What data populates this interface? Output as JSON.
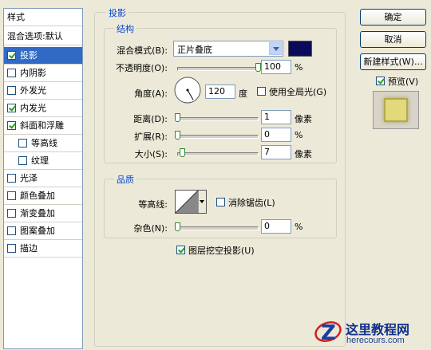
{
  "sidebar": {
    "header": "样式",
    "blend_options": "混合选项:默认",
    "items": [
      {
        "label": "投影",
        "checked": true,
        "selected": true
      },
      {
        "label": "内阴影",
        "checked": false
      },
      {
        "label": "外发光",
        "checked": false
      },
      {
        "label": "内发光",
        "checked": true
      },
      {
        "label": "斜面和浮雕",
        "checked": true
      },
      {
        "label": "等高线",
        "checked": false,
        "indent": true
      },
      {
        "label": "纹理",
        "checked": false,
        "indent": true
      },
      {
        "label": "光泽",
        "checked": false
      },
      {
        "label": "颜色叠加",
        "checked": false
      },
      {
        "label": "渐变叠加",
        "checked": false
      },
      {
        "label": "图案叠加",
        "checked": false
      },
      {
        "label": "描边",
        "checked": false
      }
    ]
  },
  "panel": {
    "title": "投影",
    "structure": {
      "title": "结构",
      "blend_mode_label": "混合模式(B):",
      "blend_mode_value": "正片叠底",
      "shadow_color": "#0a0a5a",
      "opacity_label": "不透明度(O):",
      "opacity_value": "100",
      "opacity_level": 100,
      "opacity_unit": "%",
      "angle_label": "角度(A):",
      "angle_value": "120",
      "angle_unit": "度",
      "global_light_label": "使用全局光(G)",
      "global_light_checked": false,
      "distance_label": "距离(D):",
      "distance_value": "1",
      "distance_unit": "像素",
      "spread_label": "扩展(R):",
      "spread_value": "0",
      "spread_unit": "%",
      "size_label": "大小(S):",
      "size_value": "7",
      "size_unit": "像素"
    },
    "quality": {
      "title": "品质",
      "contour_label": "等高线:",
      "anti_alias_label": "消除锯齿(L)",
      "anti_alias_checked": false,
      "noise_label": "杂色(N):",
      "noise_value": "0",
      "noise_unit": "%"
    },
    "knockout_label": "图层挖空投影(U)",
    "knockout_checked": true
  },
  "buttons": {
    "ok": "确定",
    "cancel": "取消",
    "new_style": "新建样式(W)...",
    "preview_label": "预览(V)",
    "preview_checked": true
  },
  "watermark": {
    "title": "这里教程网",
    "url": "herecours.com"
  }
}
